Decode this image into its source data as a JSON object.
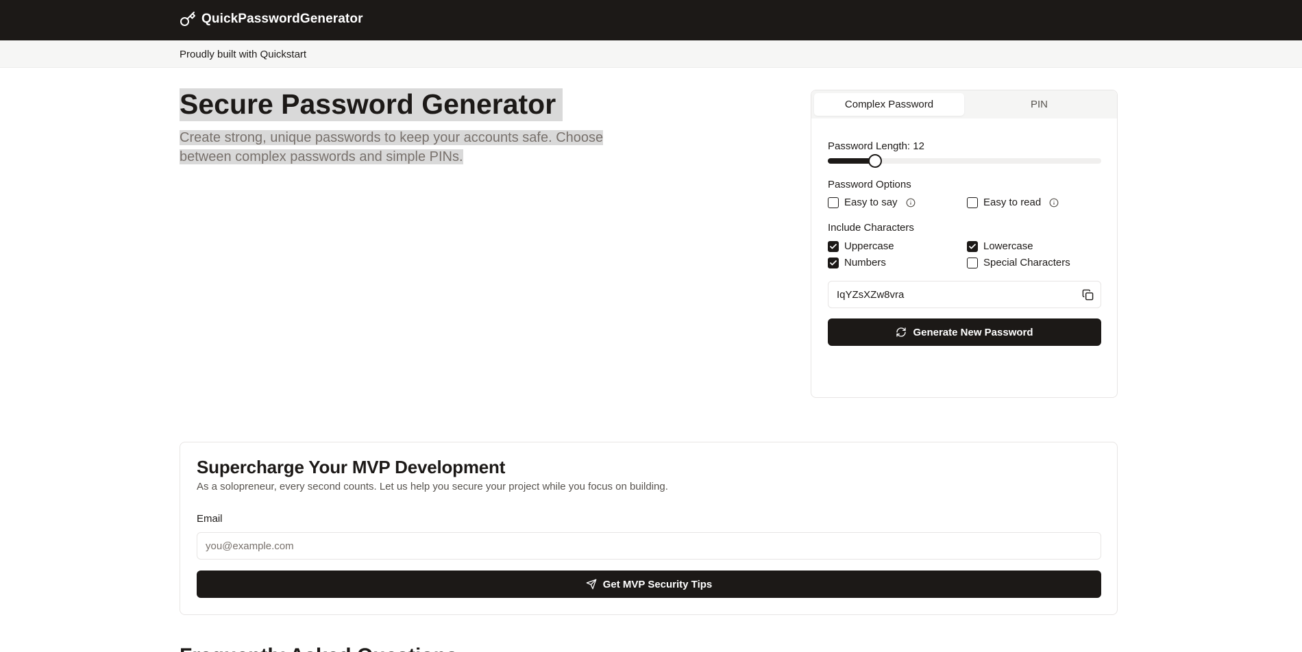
{
  "header": {
    "brand_name": "QuickPasswordGenerator",
    "brand_icon": "key-icon"
  },
  "subbar": {
    "text": "Proudly built with Quickstart"
  },
  "hero": {
    "title": "Secure Password Generator",
    "subtitle": "Create strong, unique passwords to keep your accounts safe. Choose between complex passwords and simple PINs."
  },
  "generator": {
    "tabs": [
      {
        "label": "Complex Password",
        "active": true
      },
      {
        "label": "PIN",
        "active": false
      }
    ],
    "length_label": "Password Length: 12",
    "length": {
      "value": 12,
      "min": 4,
      "max": 50
    },
    "options_label": "Password Options",
    "options": [
      {
        "label": "Easy to say",
        "checked": false,
        "icon": "info-icon"
      },
      {
        "label": "Easy to read",
        "checked": false,
        "icon": "info-icon"
      }
    ],
    "include_label": "Include Characters",
    "characters": [
      {
        "label": "Uppercase",
        "checked": true
      },
      {
        "label": "Lowercase",
        "checked": true
      },
      {
        "label": "Numbers",
        "checked": true
      },
      {
        "label": "Special Characters",
        "checked": false
      }
    ],
    "password_value": "IqYZsXZw8vra",
    "copy_icon": "copy-icon",
    "generate_label": "Generate New Password",
    "generate_icon": "refresh-icon"
  },
  "mvp": {
    "title": "Supercharge Your MVP Development",
    "subtitle": "As a solopreneur, every second counts. Let us help you secure your project while you focus on building.",
    "email_label": "Email",
    "email_placeholder": "you@example.com",
    "email_value": "",
    "button_label": "Get MVP Security Tips",
    "button_icon": "send-icon"
  },
  "faq": {
    "heading": "Frequently Asked Questions"
  },
  "colors": {
    "primary": "#1c1917",
    "muted_text": "#78716c",
    "border": "#e7e5e4",
    "highlight": "#d9d9d9"
  }
}
